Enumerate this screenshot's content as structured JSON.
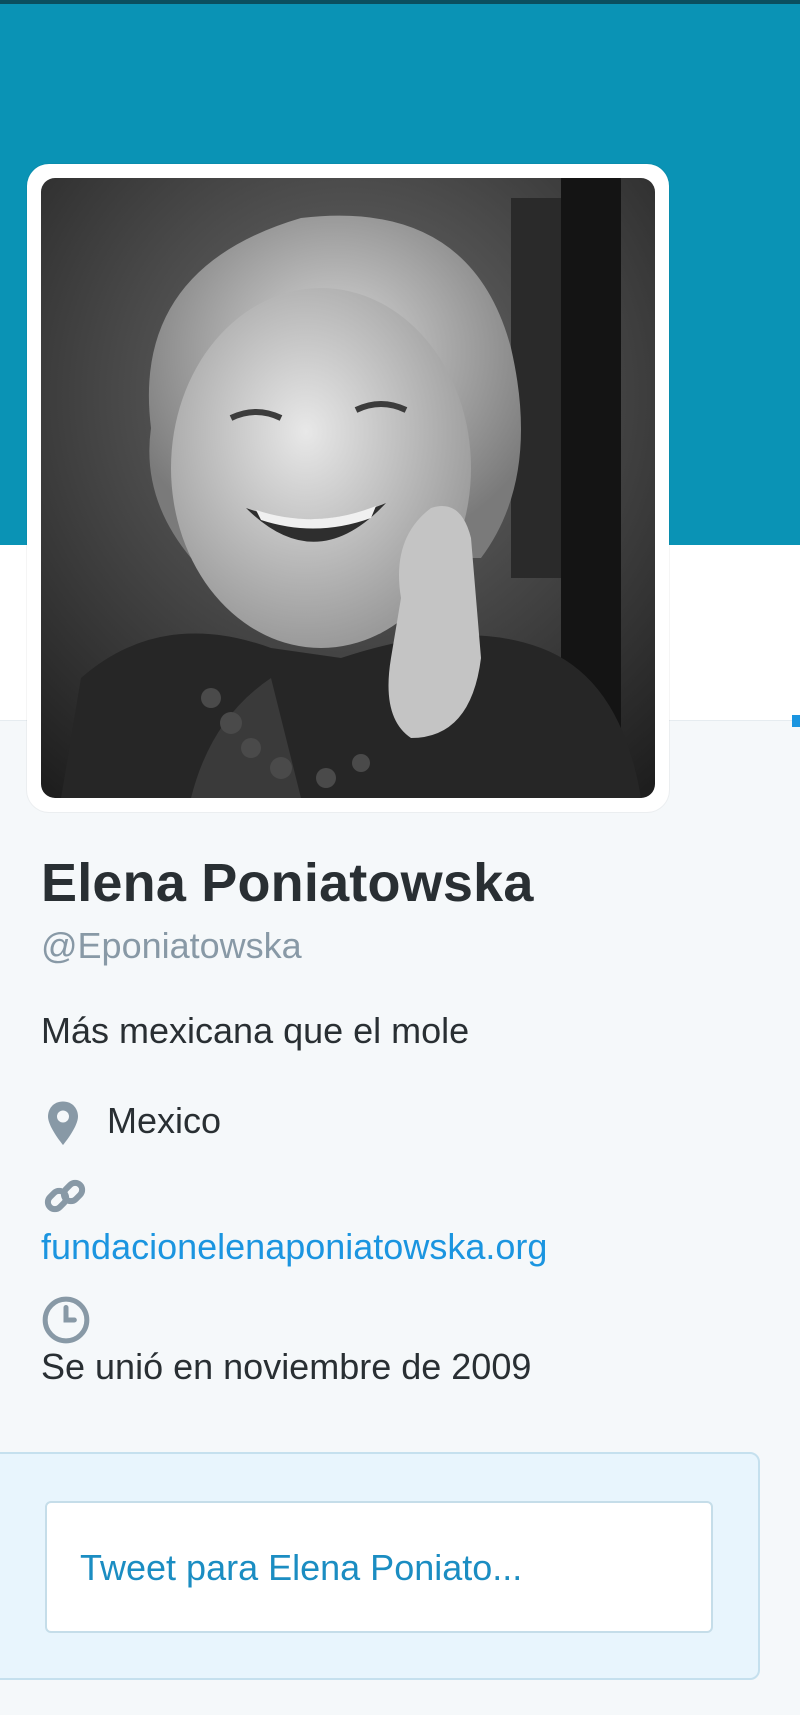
{
  "colors": {
    "banner": "#0a93b5",
    "panel": "#f5f8fa",
    "link": "#1b95e0",
    "text": "#292f33",
    "muted": "#8899a6"
  },
  "profile": {
    "name": "Elena Poniatowska",
    "handle": "@Eponiatowska",
    "bio": "Más mexicana que el mole",
    "location": "Mexico",
    "website": "fundacionelenaponiatowska.org",
    "joined": "Se unió en noviembre de 2009"
  },
  "icons": {
    "location": "map-pin-icon",
    "website": "link-icon",
    "joined": "clock-icon"
  },
  "tweet_box": {
    "placeholder": "Tweet para Elena Poniato..."
  }
}
